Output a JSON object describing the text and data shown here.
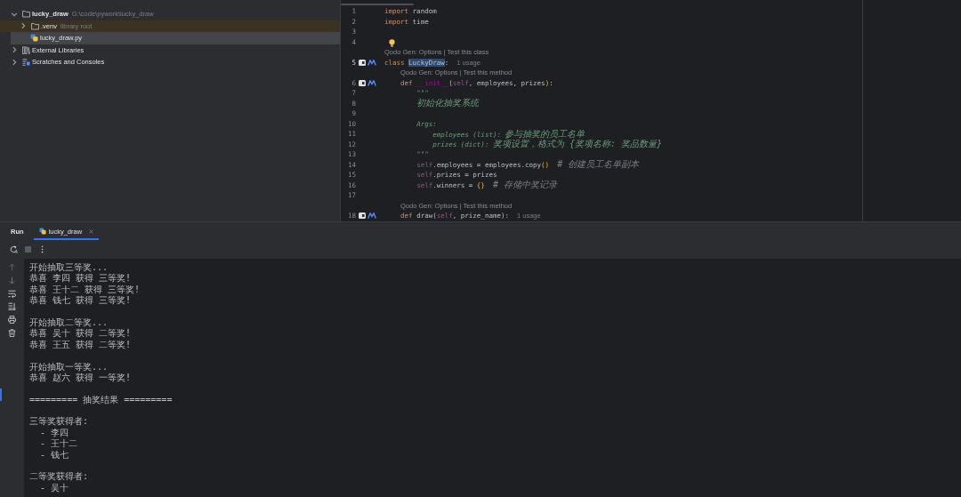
{
  "project": {
    "tree": [
      {
        "label": "lucky_draw",
        "detail": "G:\\code\\pywork\\lucky_draw",
        "kind": "folder",
        "expanded": true,
        "selected": false,
        "highlighted": false,
        "children": [
          {
            "label": ".venv",
            "detail": "library root",
            "kind": "folder",
            "expanded": false,
            "selected": false,
            "highlighted": true
          },
          {
            "label": "lucky_draw.py",
            "kind": "python",
            "selected": true,
            "highlighted": false
          }
        ]
      },
      {
        "label": "External Libraries",
        "kind": "libraries",
        "expanded": false,
        "selected": false,
        "highlighted": false
      },
      {
        "label": "Scratches and Consoles",
        "kind": "scratches",
        "expanded": false,
        "selected": false,
        "highlighted": false
      }
    ]
  },
  "editor": {
    "rows": [
      {
        "kind": "code",
        "number": "1",
        "current": false,
        "markers": false,
        "tokens": [
          {
            "kind": "kw",
            "text": "import"
          },
          {
            "kind": "plain",
            "text": " random"
          }
        ]
      },
      {
        "kind": "code",
        "number": "2",
        "current": false,
        "markers": false,
        "tokens": [
          {
            "kind": "kw",
            "text": "import"
          },
          {
            "kind": "plain",
            "text": " time"
          }
        ]
      },
      {
        "kind": "code",
        "number": "3",
        "current": false,
        "markers": false
      },
      {
        "kind": "code",
        "number": "4",
        "current": false,
        "markers": false
      },
      {
        "kind": "inlay",
        "indented": false,
        "bulb": true,
        "text": "Qodo Gen: Options | Test this class"
      },
      {
        "kind": "code",
        "number": "5",
        "current": true,
        "markers": true,
        "tokens": [
          {
            "kind": "kw",
            "text": "class "
          },
          {
            "kind": "match",
            "text": "LuckyDraw"
          },
          {
            "kind": "plain",
            "text": ":"
          }
        ],
        "hint": "1 usage"
      },
      {
        "kind": "inlay",
        "indented": true,
        "bulb": false,
        "text": "Qodo Gen: Options | Test this method"
      },
      {
        "kind": "code",
        "number": "6",
        "current": false,
        "markers": true,
        "tokens": [
          {
            "kind": "kw",
            "text": "    def "
          },
          {
            "kind": "dunder",
            "text": "__init__"
          },
          {
            "kind": "plain",
            "text": "("
          },
          {
            "kind": "self",
            "text": "self"
          },
          {
            "kind": "plain",
            "text": ", employees, prizes"
          },
          {
            "kind": "brace",
            "text": ")"
          },
          {
            "kind": "plain",
            "text": ":"
          }
        ]
      },
      {
        "kind": "code",
        "number": "7",
        "current": false,
        "markers": false,
        "tokens": [
          {
            "kind": "doc",
            "text": "        \"\"\""
          }
        ]
      },
      {
        "kind": "code",
        "number": "8",
        "current": false,
        "markers": false,
        "tokens": [
          {
            "kind": "doc_wide",
            "text": "        初始化抽奖系统"
          }
        ]
      },
      {
        "kind": "code",
        "number": "9",
        "current": false,
        "markers": false
      },
      {
        "kind": "code",
        "number": "10",
        "current": false,
        "markers": false,
        "tokens": [
          {
            "kind": "doc",
            "text": "        Args:"
          }
        ]
      },
      {
        "kind": "code",
        "number": "11",
        "current": false,
        "markers": false,
        "tokens": [
          {
            "kind": "doc",
            "text": "            employees (list): "
          },
          {
            "kind": "doc_wide",
            "text": "参与抽奖的员工名单"
          }
        ]
      },
      {
        "kind": "code",
        "number": "12",
        "current": false,
        "markers": false,
        "tokens": [
          {
            "kind": "doc",
            "text": "            prizes (dict): "
          },
          {
            "kind": "doc_wide",
            "text": "奖项设置，格式为 {奖项名称: 奖品数量}"
          }
        ]
      },
      {
        "kind": "code",
        "number": "13",
        "current": false,
        "markers": false,
        "tokens": [
          {
            "kind": "doc",
            "text": "        \"\"\""
          }
        ]
      },
      {
        "kind": "code",
        "number": "14",
        "current": false,
        "markers": false,
        "tokens": [
          {
            "kind": "self",
            "text": "        self"
          },
          {
            "kind": "plain",
            "text": ".employees = employees.copy"
          },
          {
            "kind": "brace",
            "text": "()"
          },
          {
            "kind": "comment_wide",
            "text": "  # 创建员工名单副本"
          }
        ]
      },
      {
        "kind": "code",
        "number": "15",
        "current": false,
        "markers": false,
        "tokens": [
          {
            "kind": "self",
            "text": "        self"
          },
          {
            "kind": "plain",
            "text": ".prizes = prizes"
          }
        ]
      },
      {
        "kind": "code",
        "number": "16",
        "current": false,
        "markers": false,
        "tokens": [
          {
            "kind": "self",
            "text": "        self"
          },
          {
            "kind": "plain",
            "text": ".winners = "
          },
          {
            "kind": "brace",
            "text": "{}"
          },
          {
            "kind": "comment_wide",
            "text": "  # 存储中奖记录"
          }
        ]
      },
      {
        "kind": "code",
        "number": "17",
        "current": false,
        "markers": false
      },
      {
        "kind": "inlay",
        "indented": true,
        "bulb": false,
        "text": "Qodo Gen: Options | Test this method"
      },
      {
        "kind": "code",
        "number": "18",
        "current": false,
        "markers": true,
        "tokens": [
          {
            "kind": "kw",
            "text": "    def"
          },
          {
            "kind": "plain",
            "text": " draw("
          },
          {
            "kind": "self",
            "text": "self"
          },
          {
            "kind": "plain",
            "text": ", prize_name):"
          }
        ],
        "hint": "1 usage"
      }
    ]
  },
  "run": {
    "title": "Run",
    "tabs": [
      {
        "label": "lucky_draw",
        "selected": true
      }
    ],
    "console": [
      [
        "开始抽取三等奖...",
        "恭喜 李四 获得 三等奖!",
        "恭喜 王十二 获得 三等奖!",
        "恭喜 钱七 获得 三等奖!"
      ],
      [
        "开始抽取二等奖...",
        "恭喜 吴十 获得 二等奖!",
        "恭喜 王五 获得 二等奖!"
      ],
      [
        "开始抽取一等奖...",
        "恭喜 赵六 获得 一等奖!"
      ],
      [
        "========= 抽奖结果 ========="
      ],
      [
        "三等奖获得者:",
        "  - 李四",
        "  - 王十二",
        "  - 钱七"
      ],
      [
        "二等奖获得者:",
        "  - 吴十"
      ]
    ]
  }
}
